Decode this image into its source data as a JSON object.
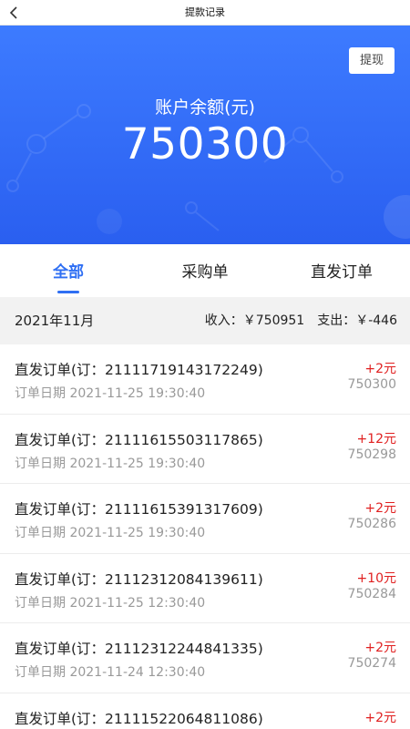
{
  "nav": {
    "title": "提款记录",
    "back_icon": "chevron-left-icon"
  },
  "hero": {
    "withdraw_label": "提现",
    "balance_label": "账户余额(元)",
    "balance_value": "750300",
    "colors": {
      "gradient_top": "#3d7bff",
      "gradient_bottom": "#2a5ff0"
    }
  },
  "tabs": [
    {
      "label": "全部",
      "active": true
    },
    {
      "label": "采购单",
      "active": false
    },
    {
      "label": "直发订单",
      "active": false
    }
  ],
  "accent_color": "#2f6ff3",
  "month": {
    "label": "2021年11月",
    "income": "收入：￥750951",
    "expense": "支出：￥-446"
  },
  "records": [
    {
      "title": "直发订单(订：21111719143172249)",
      "date": "订单日期 2021-11-25 19:30:40",
      "amount": "+2元",
      "balance": "750300"
    },
    {
      "title": "直发订单(订：21111615503117865)",
      "date": "订单日期 2021-11-25 19:30:40",
      "amount": "+12元",
      "balance": "750298"
    },
    {
      "title": "直发订单(订：21111615391317609)",
      "date": "订单日期 2021-11-25 19:30:40",
      "amount": "+2元",
      "balance": "750286"
    },
    {
      "title": "直发订单(订：21112312084139611)",
      "date": "订单日期 2021-11-25 12:30:40",
      "amount": "+10元",
      "balance": "750284"
    },
    {
      "title": "直发订单(订：21112312244841335)",
      "date": "订单日期 2021-11-24 12:30:40",
      "amount": "+2元",
      "balance": "750274"
    },
    {
      "title": "直发订单(订：21111522064811086)",
      "date": "",
      "amount": "+2元",
      "balance": ""
    }
  ]
}
